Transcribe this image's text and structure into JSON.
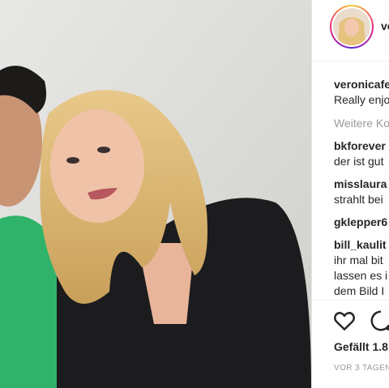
{
  "post": {
    "image_description_icon": "photo",
    "author": "veronicafe",
    "caption_user": "veronicafe",
    "caption_text": "Really enjo",
    "more_comments": "Weitere Ko",
    "comments": [
      {
        "user": "bkforever",
        "text": "der ist gut"
      },
      {
        "user": "misslaura",
        "text": "strahlt bei"
      },
      {
        "user": "gklepper6",
        "text": ""
      },
      {
        "user": "bill_kaulit",
        "text": "ihr mal bit"
      },
      {
        "user": "",
        "text": "lassen es i"
      },
      {
        "user": "",
        "text": "dem Bild I"
      }
    ],
    "likes": "Gefällt 1.8",
    "timestamp": "VOR 3 TAGEN"
  },
  "icons": {
    "like": "heart-icon",
    "comment": "comment-bubble-icon"
  },
  "colors": {
    "text": "#262626",
    "muted": "#999999",
    "divider": "#efefef"
  }
}
